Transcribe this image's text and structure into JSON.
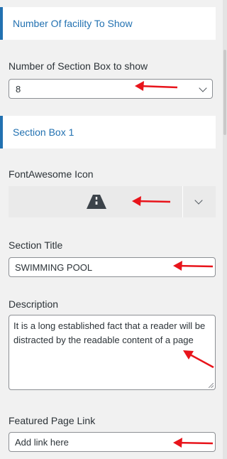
{
  "facility_header": {
    "title": "Number Of facility To Show"
  },
  "section_count": {
    "label": "Number of Section Box to show",
    "value": "8"
  },
  "section_box_header": {
    "title": "Section Box 1"
  },
  "fontawesome": {
    "label": "FontAwesome Icon",
    "icon": "road-icon"
  },
  "section_title": {
    "label": "Section Title",
    "value": "SWIMMING POOL"
  },
  "description": {
    "label": "Description",
    "value": "It is a long established fact that a reader will be distracted by the readable content of a page"
  },
  "featured_link": {
    "label": "Featured Page Link",
    "placeholder": "Add link here"
  },
  "colors": {
    "accent": "#2271b1",
    "annotation_arrow": "#e8141b",
    "background": "#f1f1f1"
  }
}
